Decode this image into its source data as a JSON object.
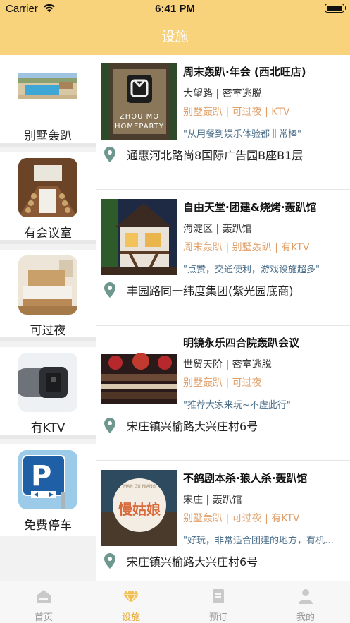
{
  "status_bar": {
    "carrier": "Carrier",
    "time": "6:41 PM"
  },
  "nav": {
    "title": "设施"
  },
  "sidebar": {
    "items": [
      {
        "label": "别墅轰趴",
        "icon": "villa-pool-image"
      },
      {
        "label": "有会议室",
        "icon": "meeting-room-image"
      },
      {
        "label": "可过夜",
        "icon": "bedroom-image"
      },
      {
        "label": "有KTV",
        "icon": "microphone-image"
      },
      {
        "label": "免费停车",
        "icon": "parking-sign-image"
      }
    ]
  },
  "venues": [
    {
      "name": "周末轰趴·年会 (西北旺店)",
      "area": "大望路 | 密室逃脱",
      "tags": "别墅轰趴 | 可过夜 | KTV",
      "quote": "\"从用餐到娱乐体验都非常棒\"",
      "address": "通惠河北路尚8国际广告园B座B1层",
      "photo_text_1": "ZHOU MO",
      "photo_text_2": "HOMEPARTY"
    },
    {
      "name": "自由天堂·团建&烧烤·轰趴馆",
      "area": "海淀区 | 轰趴馆",
      "tags": "周末轰趴 | 别墅轰趴 | 有KTV",
      "quote": "\"点赞，交通便利，游戏设施超多\"",
      "address": "丰园路同一纬度集团(紫光园底商)"
    },
    {
      "name": "明镜永乐四合院轰趴会议",
      "area": "世贸天阶 | 密室逃脱",
      "tags": "别墅轰趴 | 可过夜",
      "quote": "\"推荐大家来玩~不虚此行\"",
      "address": "宋庄镇兴榆路大兴庄村6号"
    },
    {
      "name": "不鸽剧本杀·狼人杀·轰趴馆",
      "area": "宋庄 | 轰趴馆",
      "tags": "别墅轰趴 | 可过夜 | 有KTV",
      "quote": "\"好玩，非常适合团建的地方，有机会还会再来\"",
      "address": "宋庄镇兴榆路大兴庄村6号",
      "photo_logo_text": "慢姑娘",
      "photo_logo_sub": "MAN GU NIANG"
    }
  ],
  "tabbar": {
    "tabs": [
      {
        "label": "首页",
        "icon": "home-icon"
      },
      {
        "label": "设施",
        "icon": "diamond-icon",
        "active": true
      },
      {
        "label": "预订",
        "icon": "document-icon"
      },
      {
        "label": "我的",
        "icon": "person-icon"
      }
    ]
  },
  "colors": {
    "accent": "#f9d27c",
    "tag": "#e0a06a",
    "active_tab": "#e8a830",
    "quote": "#4a6e8a"
  }
}
